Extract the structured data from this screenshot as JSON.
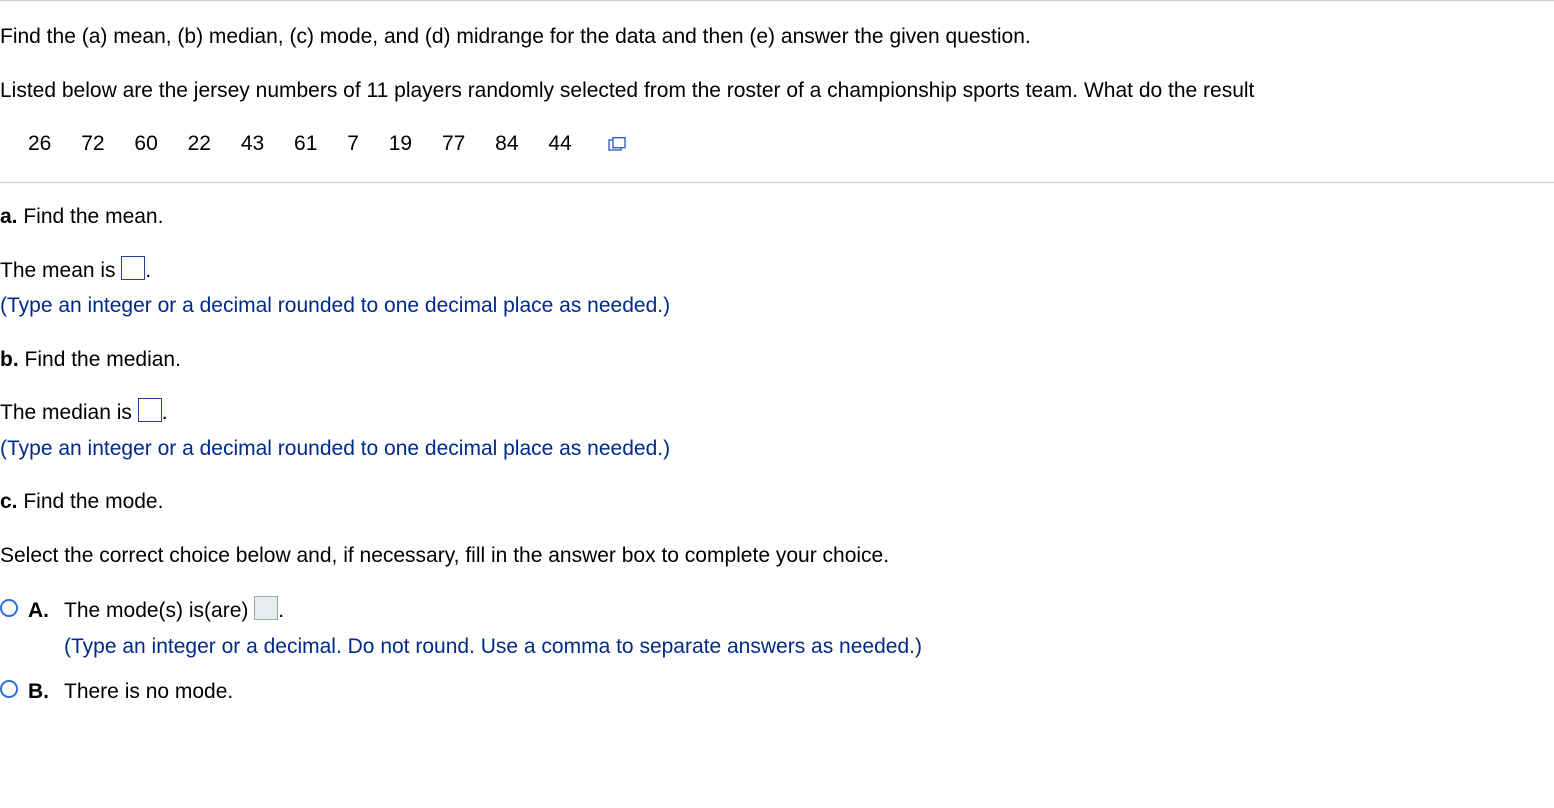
{
  "prompt": {
    "line1": "Find the (a) mean, (b) median, (c) mode, and (d) midrange for the data and then (e) answer the given question.",
    "line2": "Listed below are the jersey numbers of 11 players randomly selected from the roster of a championship sports team. What do the result"
  },
  "data_values": [
    "26",
    "72",
    "60",
    "22",
    "43",
    "61",
    "7",
    "19",
    "77",
    "84",
    "44"
  ],
  "partA": {
    "letter": "a.",
    "title": "Find the mean.",
    "answer_prefix": "The mean is ",
    "answer_suffix": ".",
    "hint": "(Type an integer or a decimal rounded to one decimal place as needed.)"
  },
  "partB": {
    "letter": "b.",
    "title": "Find the median.",
    "answer_prefix": "The median is ",
    "answer_suffix": ".",
    "hint": "(Type an integer or a decimal rounded to one decimal place as needed.)"
  },
  "partC": {
    "letter": "c.",
    "title": "Find the mode.",
    "instruction": "Select the correct choice below and, if necessary, fill in the answer box to complete your choice."
  },
  "choiceA": {
    "letter": "A.",
    "text_prefix": "The mode(s) is(are) ",
    "text_suffix": ".",
    "hint": "(Type an integer or a decimal. Do not round. Use a comma to separate answers as needed.)"
  },
  "choiceB": {
    "letter": "B.",
    "text": "There is no mode."
  }
}
